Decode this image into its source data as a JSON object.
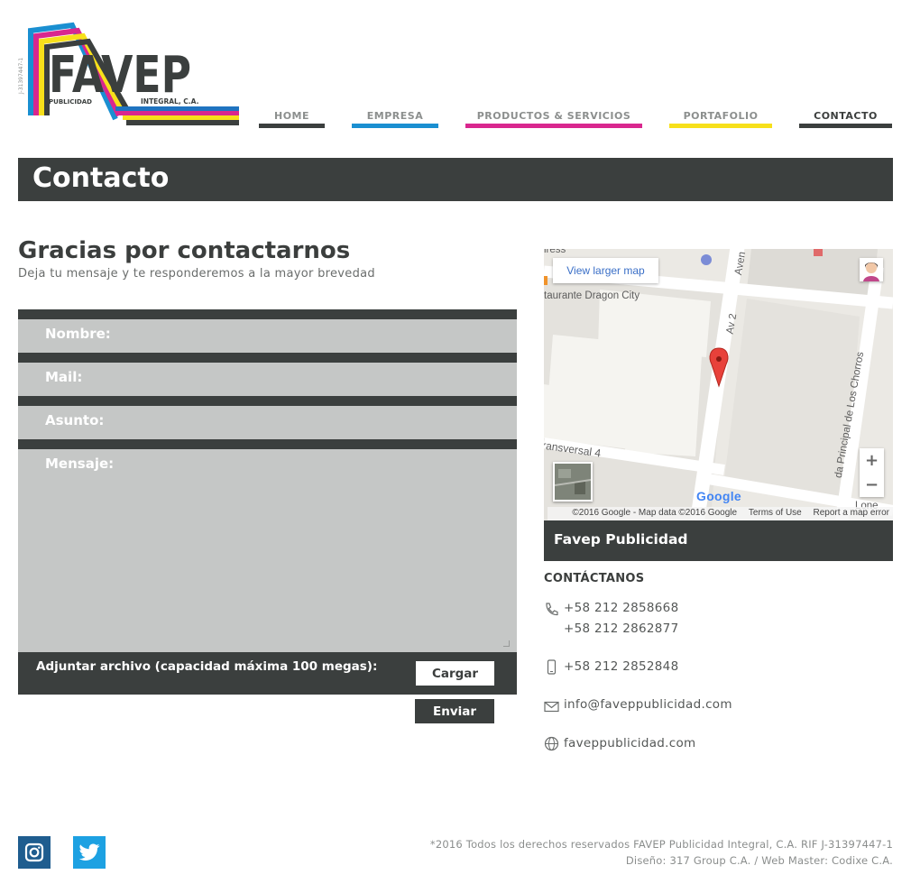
{
  "brand": {
    "logo_text": "FAVEP",
    "logo_sub_left": "PUBLICIDAD",
    "logo_sub_right": "INTEGRAL, C.A.",
    "logo_side": "J-31397447-1",
    "colors": {
      "dark": "#3b3f3e",
      "cyan": "#1a8fd1",
      "magenta": "#d9278e",
      "yellow": "#f7e01a",
      "blue": "#1f74c0"
    }
  },
  "nav": [
    {
      "label": "HOME",
      "color": "#3b3f3e",
      "active": false
    },
    {
      "label": "EMPRESA",
      "color": "#1a8fd1",
      "active": false
    },
    {
      "label": "PRODUCTOS & SERVICIOS",
      "color": "#d9278e",
      "active": false
    },
    {
      "label": "PORTAFOLIO",
      "color": "#f7e01a",
      "active": false
    },
    {
      "label": "CONTACTO",
      "color": "#3b3f3e",
      "active": true
    }
  ],
  "page_title": "Contacto",
  "left": {
    "title": "Gracias por contactarnos",
    "subtitle": "Deja tu mensaje y te responderemos a la mayor brevedad"
  },
  "form": {
    "name_label": "Nombre:",
    "mail_label": "Mail:",
    "subject_label": "Asunto:",
    "message_label": "Mensaje:",
    "attach_label": "Adjuntar archivo (capacidad máxima 100 megas):",
    "upload_button": "Cargar",
    "submit_button": "Enviar"
  },
  "map": {
    "larger_map": "View larger map",
    "zoom_in": "+",
    "zoom_out": "−",
    "google": "Google",
    "attribution": "©2016 Google - Map data ©2016 Google",
    "terms": "Terms of Use",
    "report": "Report a map error",
    "labels": {
      "restaurant": "taurante Dragon City",
      "av2": "Av 2",
      "transversal": "ransversal 4",
      "principal": "da Principal de Los Chorros",
      "aven": "Aven",
      "lress": "lress",
      "lone": "Lone"
    }
  },
  "card": {
    "company": "Favep Publicidad",
    "heading": "CONTÁCTANOS",
    "phone1": "+58 212 2858668",
    "phone2": "+58 212 2862877",
    "mobile": "+58 212 2852848",
    "email": "info@faveppublicidad.com",
    "web": "faveppublicidad.com"
  },
  "footer": {
    "rights": "*2016 Todos los derechos reservados FAVEP Publicidad Integral, C.A. RIF J-31397447-1",
    "credits": "Diseño: 317 Group C.A. / Web Master: Codixe C.A."
  }
}
